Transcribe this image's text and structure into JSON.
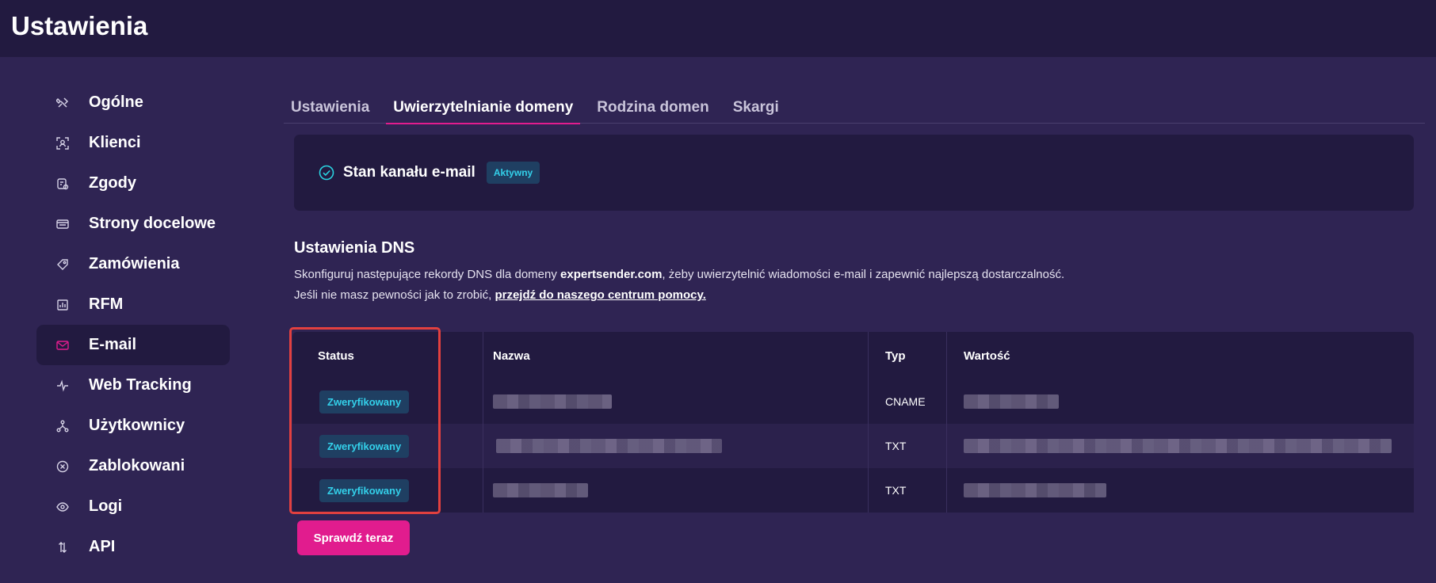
{
  "header": {
    "title": "Ustawienia"
  },
  "sidebar": {
    "items": [
      {
        "label": "Ogólne",
        "icon": "tools-icon"
      },
      {
        "label": "Klienci",
        "icon": "user-frame-icon"
      },
      {
        "label": "Zgody",
        "icon": "consent-icon"
      },
      {
        "label": "Strony docelowe",
        "icon": "landing-page-icon"
      },
      {
        "label": "Zamówienia",
        "icon": "tag-icon"
      },
      {
        "label": "RFM",
        "icon": "chart-icon"
      },
      {
        "label": "E-mail",
        "icon": "envelope-icon",
        "active": true
      },
      {
        "label": "Web Tracking",
        "icon": "pulse-icon"
      },
      {
        "label": "Użytkownicy",
        "icon": "network-icon"
      },
      {
        "label": "Zablokowani",
        "icon": "blocked-icon"
      },
      {
        "label": "Logi",
        "icon": "eye-icon"
      },
      {
        "label": "API",
        "icon": "arrows-vertical-icon"
      }
    ]
  },
  "tabs": [
    {
      "label": "Ustawienia"
    },
    {
      "label": "Uwierzytelnianie domeny",
      "active": true
    },
    {
      "label": "Rodzina domen"
    },
    {
      "label": "Skargi"
    }
  ],
  "channel": {
    "label": "Stan kanału e-mail",
    "status": "Aktywny"
  },
  "dns": {
    "title": "Ustawienia DNS",
    "line1_pre": "Skonfiguruj następujące rekordy DNS dla domeny ",
    "domain": "expertsender.com",
    "line1_post": ", żeby uwierzytelnić wiadomości e-mail i zapewnić najlepszą dostarczalność.",
    "line2_pre": "Jeśli nie masz pewności jak to zrobić, ",
    "link": "przejdź do naszego centrum pomocy."
  },
  "table": {
    "headers": {
      "status": "Status",
      "name": "Nazwa",
      "type": "Typ",
      "value": "Wartość"
    },
    "rows": [
      {
        "status": "Zweryfikowany",
        "type": "CNAME"
      },
      {
        "status": "Zweryfikowany",
        "type": "TXT"
      },
      {
        "status": "Zweryfikowany",
        "type": "TXT"
      }
    ]
  },
  "actions": {
    "check_now": "Sprawdź teraz"
  },
  "colors": {
    "accent": "#e11c8e",
    "badge_text": "#33d0ea",
    "highlight": "#e2403f"
  }
}
